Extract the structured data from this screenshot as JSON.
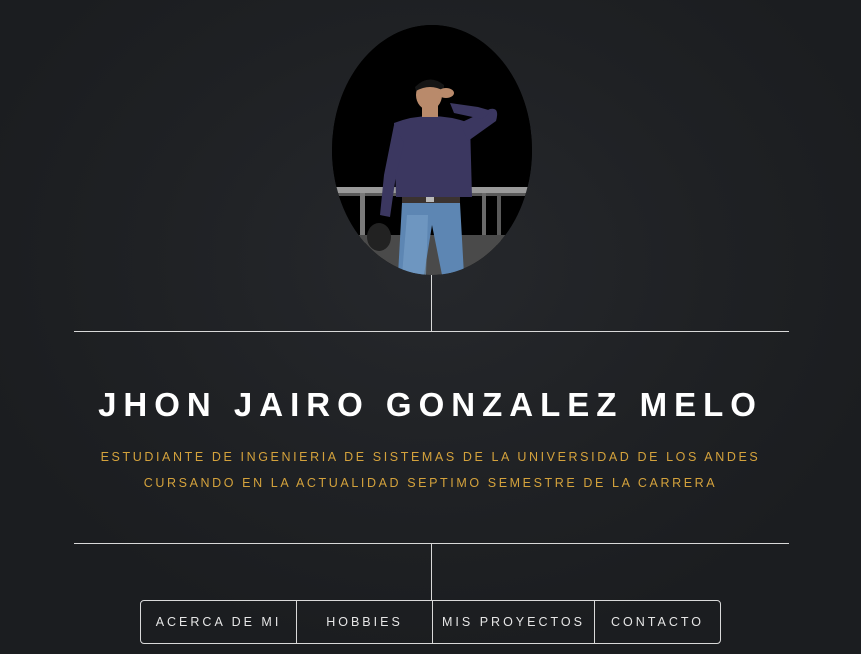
{
  "profile": {
    "name": "JHON JAIRO GONZALEZ MELO",
    "tagline_line1": "ESTUDIANTE DE INGENIERIA DE SISTEMAS DE LA UNIVERSIDAD DE LOS ANDES",
    "tagline_line2": "CURSANDO EN LA ACTUALIDAD SEPTIMO SEMESTRE DE LA CARRERA"
  },
  "nav": {
    "items": [
      {
        "label": "ACERCA DE MI"
      },
      {
        "label": "HOBBIES"
      },
      {
        "label": "MIS PROYECTOS"
      },
      {
        "label": "CONTACTO"
      }
    ]
  },
  "colors": {
    "background": "#1f2124",
    "accent": "#d4a23c",
    "line": "#d9d9d9",
    "text": "#ffffff"
  }
}
